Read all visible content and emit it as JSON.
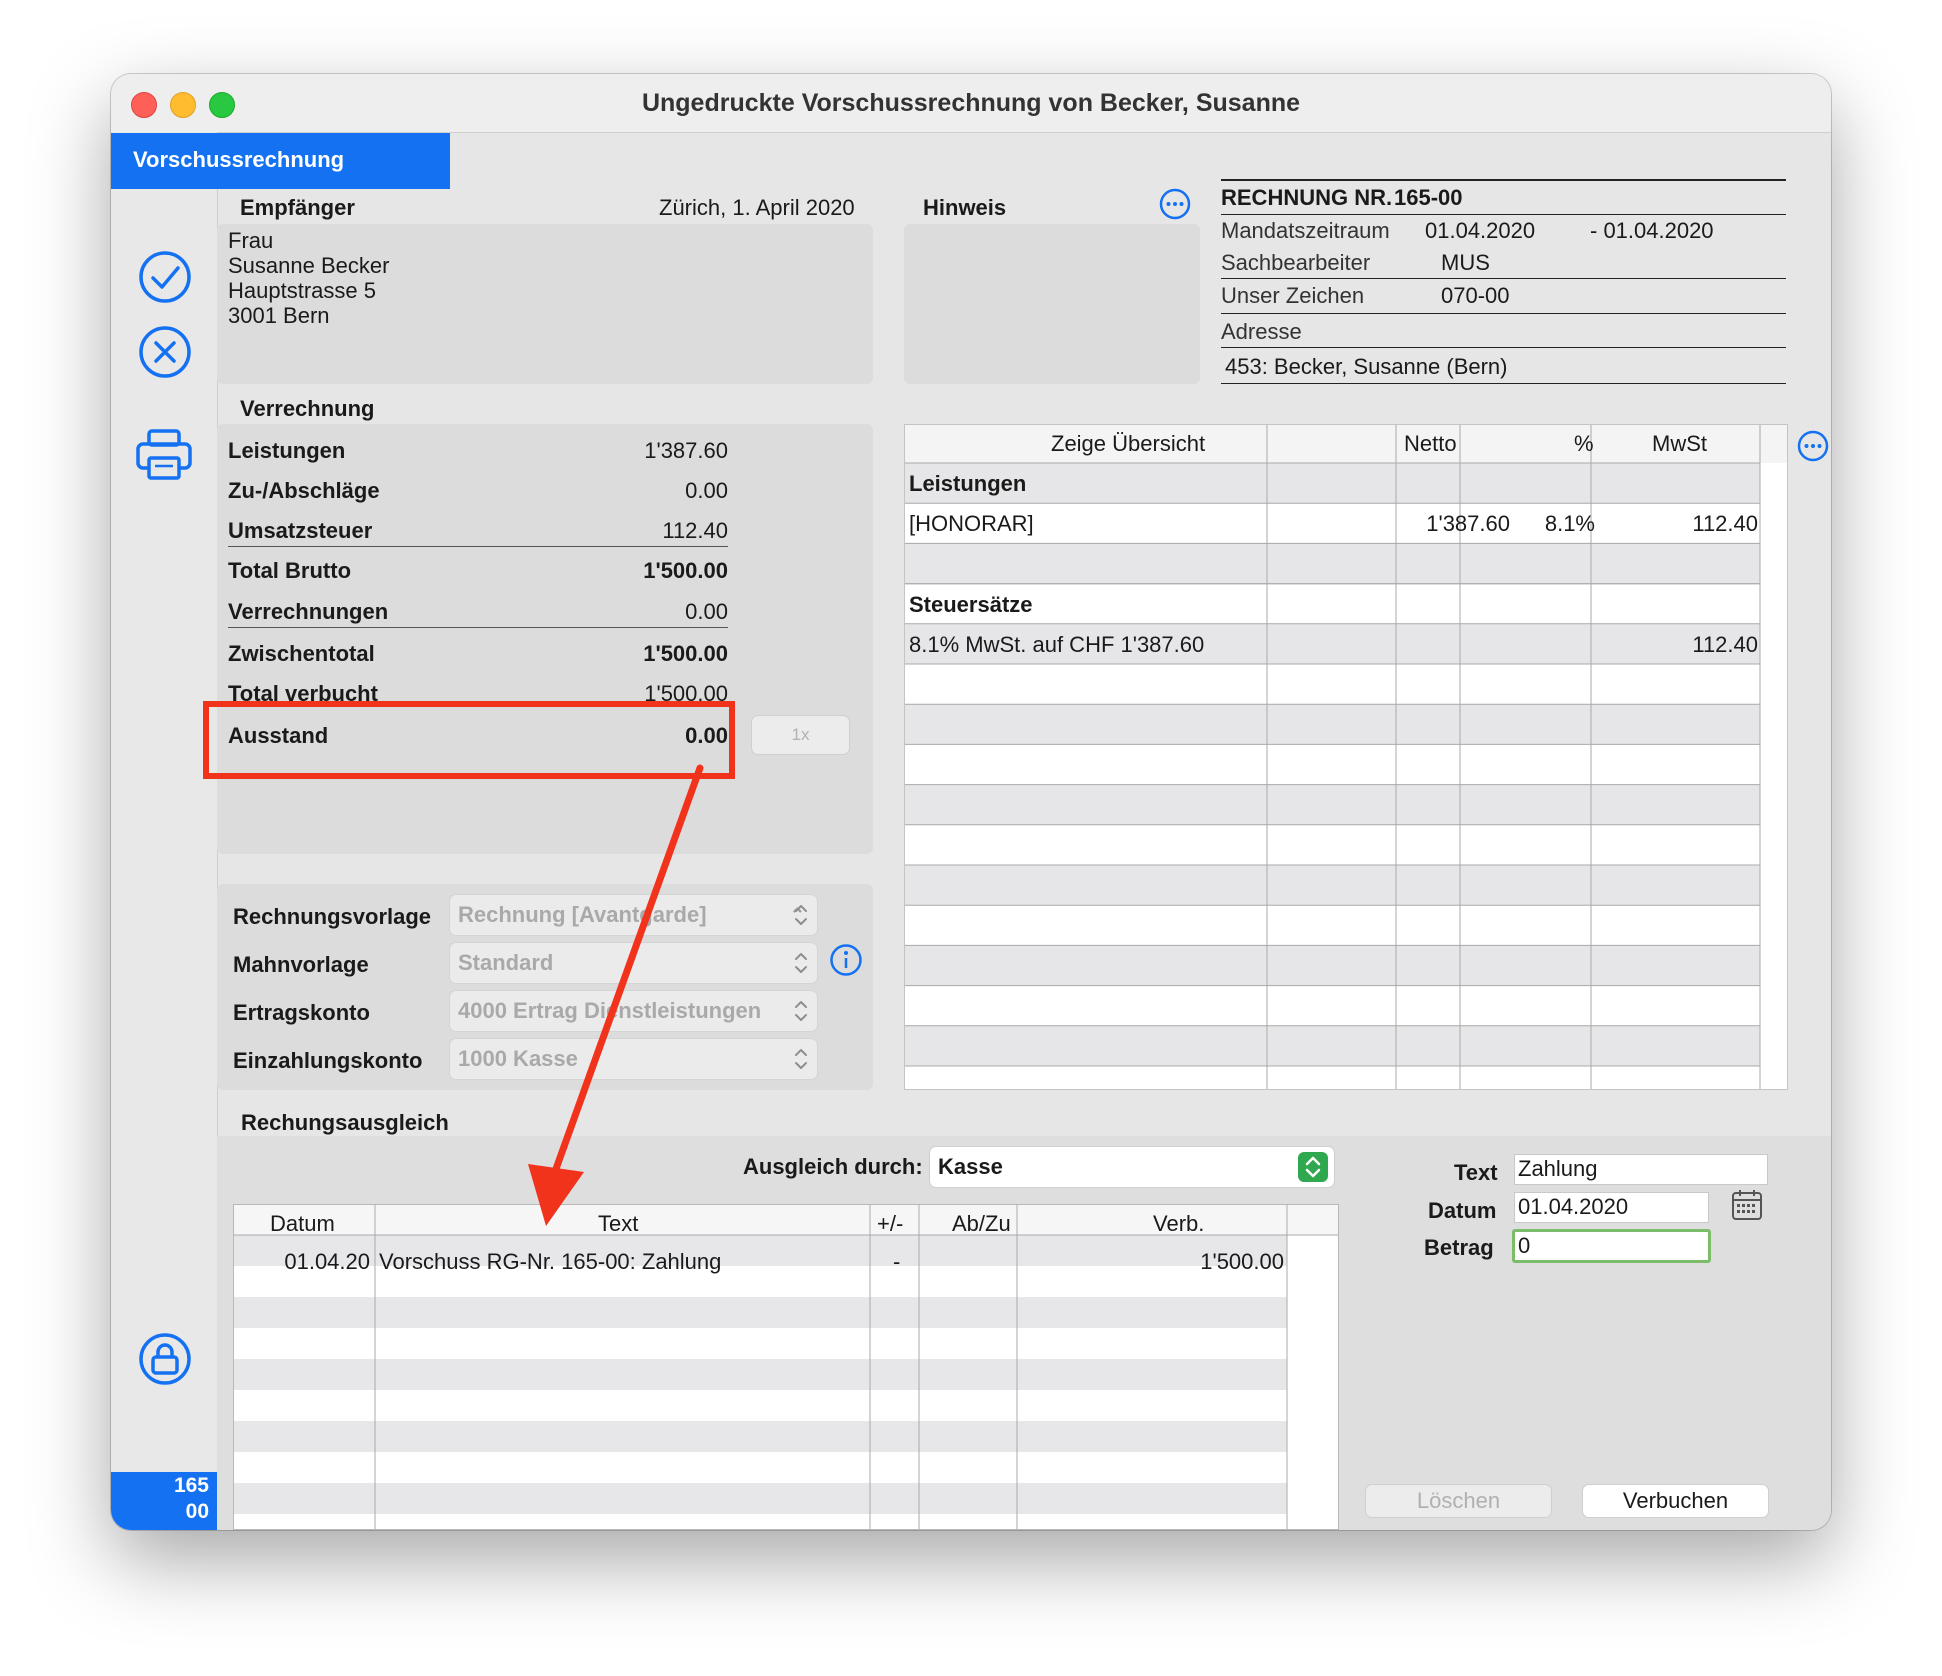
{
  "window": {
    "title": "Ungedruckte Vorschussrechnung von Becker, Susanne"
  },
  "tab": {
    "label": "Vorschussrechnung"
  },
  "sidebar": {
    "badge_line1": "165",
    "badge_line2": "00"
  },
  "recipient": {
    "heading": "Empfänger",
    "place_date": "Zürich, 1. April 2020",
    "lines": [
      "Frau",
      "Susanne Becker",
      "Hauptstrasse 5",
      "3001 Bern"
    ]
  },
  "hinweis": {
    "heading": "Hinweis"
  },
  "invoice_info": {
    "nr_label": "RECHNUNG NR.",
    "nr_value": "165-00",
    "period_label": "Mandatszeitraum",
    "period_from": "01.04.2020",
    "period_to": "- 01.04.2020",
    "clerk_label": "Sachbearbeiter",
    "clerk_value": "MUS",
    "ref_label": "Unser Zeichen",
    "ref_value": "070-00",
    "address_label": "Adresse",
    "address_value": "453: Becker, Susanne (Bern)"
  },
  "verrechnung": {
    "heading": "Verrechnung",
    "rows": [
      {
        "label": "Leistungen",
        "value": "1'387.60"
      },
      {
        "label": "Zu-/Abschläge",
        "value": "0.00"
      },
      {
        "label": "Umsatzsteuer",
        "value": "112.40"
      },
      {
        "label": "Total Brutto",
        "value": "1'500.00"
      },
      {
        "label": "Verrechnungen",
        "value": "0.00"
      },
      {
        "label": "Zwischentotal",
        "value": "1'500.00"
      },
      {
        "label": "Total verbucht",
        "value": "1'500.00"
      },
      {
        "label": "Ausstand",
        "value": "0.00"
      }
    ],
    "button_1x": "1x"
  },
  "settings": {
    "rows": [
      {
        "label": "Rechnungsvorlage",
        "value": "Rechnung [Avantgarde]"
      },
      {
        "label": "Mahnvorlage",
        "value": "Standard"
      },
      {
        "label": "Ertragskonto",
        "value": "4000 Ertrag Dienstleistungen"
      },
      {
        "label": "Einzahlungskonto",
        "value": "1000 Kasse"
      }
    ]
  },
  "overview": {
    "headers": [
      "Zeige Übersicht",
      "Netto",
      "%",
      "MwSt"
    ],
    "section1": "Leistungen",
    "item": {
      "text": "[HONORAR]",
      "netto": "1'387.60",
      "pct": "8.1%",
      "mwst": "112.40"
    },
    "section2": "Steuersätze",
    "tax": {
      "text": "8.1% MwSt. auf CHF 1'387.60",
      "mwst": "112.40"
    }
  },
  "ausgleich": {
    "heading": "Rechungsausgleich",
    "by_label": "Ausgleich durch:",
    "by_value": "Kasse",
    "headers": [
      "Datum",
      "Text",
      "+/-",
      "Ab/Zu",
      "Verb."
    ],
    "row": {
      "datum": "01.04.20",
      "text": "Vorschuss RG-Nr. 165-00: Zahlung",
      "sign": "-",
      "abzu": "",
      "verb": "1'500.00"
    }
  },
  "entry": {
    "text_label": "Text",
    "text_value": "Zahlung",
    "datum_label": "Datum",
    "datum_value": "01.04.2020",
    "betrag_label": "Betrag",
    "betrag_value": "0"
  },
  "buttons": {
    "delete": "Löschen",
    "book": "Verbuchen"
  },
  "colors": {
    "accent": "#1371f2",
    "highlight": "#f2331c",
    "focus": "#7bbd6a"
  }
}
